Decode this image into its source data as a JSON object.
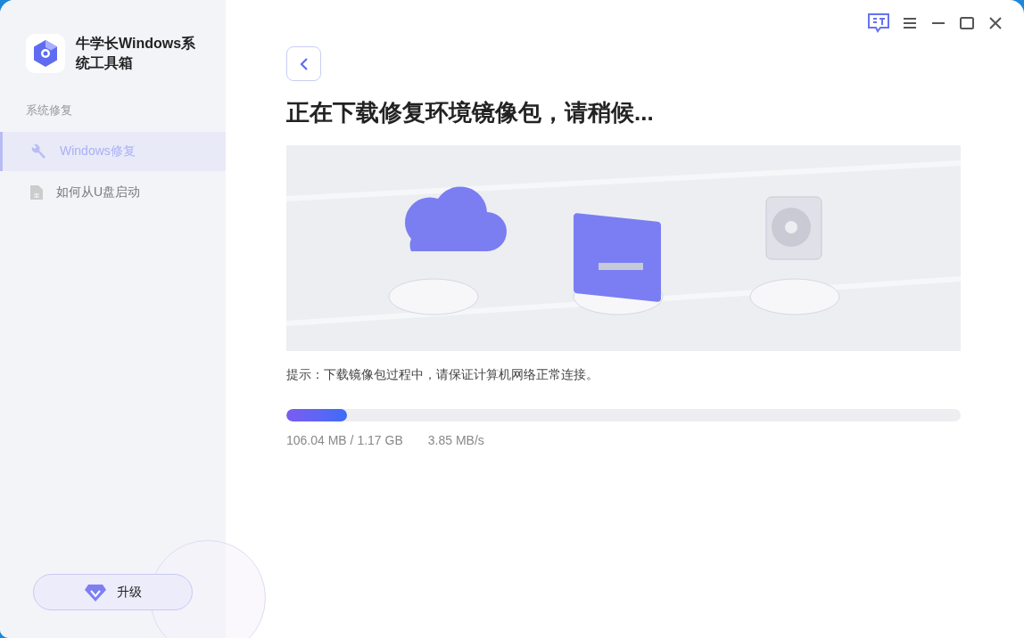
{
  "app": {
    "title": "牛学长Windows系统工具箱"
  },
  "sidebar": {
    "section": "系统修复",
    "items": [
      {
        "label": "Windows修复",
        "kind": "wrench",
        "selected": true
      },
      {
        "label": "如何从U盘启动",
        "kind": "document",
        "selected": false
      }
    ],
    "upgrade_button": "升级"
  },
  "main": {
    "heading": "正在下载修复环境镜像包，请稍候...",
    "hint": "提示：下载镜像包过程中，请保证计算机网络正常连接。",
    "progress": {
      "level": 0.09,
      "size": "106.04 MB / 1.17 GB",
      "speed": "3.85 MB/s"
    }
  }
}
